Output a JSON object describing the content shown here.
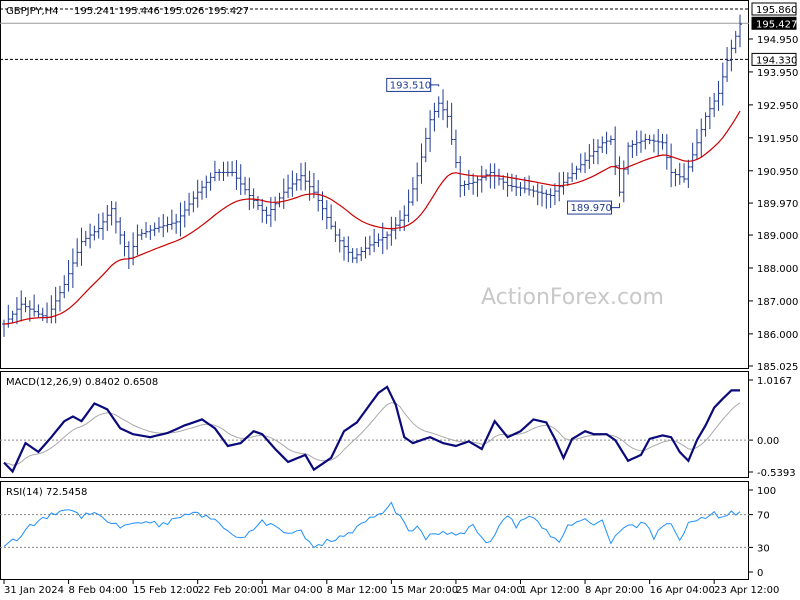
{
  "main": {
    "title": "GBPJPY,H4",
    "ohlc": "195.241 195.446 195.026 195.427",
    "watermark": "ActionForex.com",
    "price_labels": [
      "194.950",
      "193.950",
      "192.950",
      "191.950",
      "190.950",
      "189.970",
      "189.000",
      "188.000",
      "187.000",
      "186.000",
      "185.025"
    ],
    "axis_ticks": [
      194.95,
      193.95,
      192.95,
      191.95,
      190.95,
      189.97,
      189.0,
      188.0,
      187.0,
      186.0,
      185.025
    ],
    "hlines": {
      "top": 195.86,
      "current": 195.427,
      "resistance": 194.33
    },
    "boxed_labels": {
      "top": "195.860",
      "current": "195.427",
      "resistance": "194.330"
    },
    "annotations": [
      {
        "text": "193.510",
        "index": 101,
        "price": 193.51
      },
      {
        "text": "189.970",
        "index": 143,
        "price": 189.97
      }
    ]
  },
  "macd": {
    "title": "MACD(12,26,9) 0.8402 0.6508",
    "axis_labels": [
      "1.0167",
      "0.00",
      "-0.5393"
    ],
    "axis_values": [
      1.0167,
      0.0,
      -0.5393
    ]
  },
  "rsi": {
    "title": "RSI(14) 72.5458",
    "axis_labels": [
      "100",
      "70",
      "30",
      "0"
    ],
    "axis_values": [
      100,
      70,
      30,
      0
    ]
  },
  "time_axis": {
    "labels": [
      "31 Jan 2024",
      "8 Feb 04:00",
      "15 Feb 12:00",
      "22 Feb 20:00",
      "1 Mar 04:00",
      "8 Mar 12:00",
      "15 Mar 20:00",
      "25 Mar 04:00",
      "1 Apr 12:00",
      "8 Apr 20:00",
      "16 Apr 04:00",
      "23 Apr 12:00"
    ],
    "bar_index": [
      0,
      15,
      30,
      45,
      60,
      75,
      90,
      105,
      120,
      135,
      150,
      165
    ]
  },
  "colors": {
    "bars": "#1f3a93",
    "ma": "#cc0000",
    "macd": "#0a0a7a",
    "signal": "#aaaaaa",
    "rsi": "#1e90ff",
    "grid": "#888888"
  },
  "chart_data": [
    {
      "type": "ohlc",
      "title": "GBPJPY,H4",
      "moving_average": true,
      "ylim": [
        185.025,
        195.86
      ],
      "anchors": [
        [
          0,
          186.3
        ],
        [
          4,
          186.9
        ],
        [
          8,
          186.6
        ],
        [
          10,
          186.5
        ],
        [
          14,
          187.5
        ],
        [
          18,
          188.8
        ],
        [
          22,
          189.2
        ],
        [
          25,
          189.8
        ],
        [
          27,
          189.0
        ],
        [
          29,
          188.3
        ],
        [
          31,
          189.0
        ],
        [
          35,
          189.2
        ],
        [
          40,
          189.4
        ],
        [
          45,
          190.3
        ],
        [
          49,
          190.9
        ],
        [
          53,
          190.9
        ],
        [
          57,
          190.2
        ],
        [
          61,
          189.6
        ],
        [
          65,
          190.3
        ],
        [
          69,
          190.8
        ],
        [
          72,
          190.3
        ],
        [
          74,
          189.8
        ],
        [
          77,
          189.0
        ],
        [
          81,
          188.3
        ],
        [
          85,
          188.7
        ],
        [
          89,
          189.0
        ],
        [
          93,
          189.6
        ],
        [
          96,
          190.8
        ],
        [
          99,
          192.5
        ],
        [
          101,
          193.0
        ],
        [
          103,
          192.6
        ],
        [
          106,
          190.5
        ],
        [
          109,
          190.6
        ],
        [
          113,
          190.9
        ],
        [
          117,
          190.5
        ],
        [
          121,
          190.4
        ],
        [
          124,
          190.3
        ],
        [
          127,
          190.2
        ],
        [
          130,
          190.6
        ],
        [
          133,
          191.0
        ],
        [
          136,
          191.4
        ],
        [
          139,
          191.8
        ],
        [
          141,
          191.9
        ],
        [
          143,
          190.3
        ],
        [
          145,
          191.7
        ],
        [
          149,
          191.9
        ],
        [
          153,
          191.8
        ],
        [
          155,
          190.9
        ],
        [
          158,
          190.7
        ],
        [
          161,
          191.8
        ],
        [
          163,
          192.6
        ],
        [
          166,
          193.3
        ],
        [
          168,
          194.3
        ],
        [
          171,
          195.4
        ]
      ]
    },
    {
      "type": "line",
      "title": "MACD(12,26,9)",
      "series": [
        {
          "name": "MACD",
          "values": [
            0.8402
          ]
        },
        {
          "name": "Signal",
          "values": [
            0.6508
          ]
        }
      ],
      "ylim": [
        -0.5393,
        1.0167
      ],
      "anchors": [
        [
          0,
          -0.38
        ],
        [
          2,
          -0.53
        ],
        [
          5,
          -0.05
        ],
        [
          8,
          -0.2
        ],
        [
          11,
          0.05
        ],
        [
          14,
          0.32
        ],
        [
          16,
          0.4
        ],
        [
          18,
          0.32
        ],
        [
          21,
          0.62
        ],
        [
          24,
          0.52
        ],
        [
          27,
          0.2
        ],
        [
          30,
          0.1
        ],
        [
          34,
          0.05
        ],
        [
          38,
          0.12
        ],
        [
          42,
          0.25
        ],
        [
          46,
          0.35
        ],
        [
          49,
          0.2
        ],
        [
          52,
          -0.1
        ],
        [
          55,
          -0.05
        ],
        [
          58,
          0.15
        ],
        [
          60,
          0.1
        ],
        [
          63,
          -0.15
        ],
        [
          66,
          -0.37
        ],
        [
          70,
          -0.25
        ],
        [
          72,
          -0.5
        ],
        [
          76,
          -0.3
        ],
        [
          79,
          0.15
        ],
        [
          82,
          0.3
        ],
        [
          85,
          0.6
        ],
        [
          87,
          0.8
        ],
        [
          89,
          0.9
        ],
        [
          91,
          0.6
        ],
        [
          93,
          0.05
        ],
        [
          95,
          -0.05
        ],
        [
          99,
          0.05
        ],
        [
          102,
          -0.05
        ],
        [
          105,
          -0.1
        ],
        [
          108,
          -0.02
        ],
        [
          111,
          -0.15
        ],
        [
          114,
          0.32
        ],
        [
          117,
          0.05
        ],
        [
          120,
          0.15
        ],
        [
          123,
          0.35
        ],
        [
          126,
          0.3
        ],
        [
          128,
          0.02
        ],
        [
          130,
          -0.3
        ],
        [
          132,
          0.02
        ],
        [
          135,
          0.15
        ],
        [
          137,
          0.1
        ],
        [
          140,
          0.1
        ],
        [
          142,
          0.0
        ],
        [
          145,
          -0.35
        ],
        [
          148,
          -0.25
        ],
        [
          150,
          0.02
        ],
        [
          153,
          0.08
        ],
        [
          155,
          0.05
        ],
        [
          157,
          -0.2
        ],
        [
          159,
          -0.35
        ],
        [
          161,
          0.0
        ],
        [
          163,
          0.25
        ],
        [
          165,
          0.55
        ],
        [
          167,
          0.7
        ],
        [
          169,
          0.84
        ]
      ]
    },
    {
      "type": "line",
      "title": "RSI(14)",
      "series": [
        {
          "name": "RSI",
          "values": [
            72.5458
          ]
        }
      ],
      "ylim": [
        0,
        100
      ],
      "anchors": [
        [
          0,
          34
        ],
        [
          3,
          40
        ],
        [
          6,
          55
        ],
        [
          9,
          65
        ],
        [
          12,
          72
        ],
        [
          15,
          78
        ],
        [
          18,
          68
        ],
        [
          21,
          75
        ],
        [
          24,
          62
        ],
        [
          27,
          55
        ],
        [
          30,
          60
        ],
        [
          33,
          62
        ],
        [
          36,
          58
        ],
        [
          39,
          62
        ],
        [
          42,
          68
        ],
        [
          45,
          72
        ],
        [
          48,
          65
        ],
        [
          51,
          55
        ],
        [
          54,
          40
        ],
        [
          57,
          48
        ],
        [
          60,
          62
        ],
        [
          63,
          55
        ],
        [
          66,
          45
        ],
        [
          69,
          50
        ],
        [
          72,
          28
        ],
        [
          76,
          40
        ],
        [
          80,
          45
        ],
        [
          84,
          62
        ],
        [
          88,
          72
        ],
        [
          90,
          82
        ],
        [
          92,
          68
        ],
        [
          94,
          50
        ],
        [
          96,
          55
        ],
        [
          98,
          42
        ],
        [
          100,
          45
        ],
        [
          103,
          48
        ],
        [
          106,
          47
        ],
        [
          109,
          55
        ],
        [
          111,
          42
        ],
        [
          113,
          35
        ],
        [
          115,
          58
        ],
        [
          117,
          68
        ],
        [
          119,
          55
        ],
        [
          121,
          66
        ],
        [
          123,
          64
        ],
        [
          125,
          56
        ],
        [
          127,
          42
        ],
        [
          129,
          38
        ],
        [
          131,
          58
        ],
        [
          133,
          60
        ],
        [
          135,
          66
        ],
        [
          137,
          58
        ],
        [
          139,
          62
        ],
        [
          141,
          35
        ],
        [
          143,
          52
        ],
        [
          145,
          58
        ],
        [
          147,
          55
        ],
        [
          149,
          62
        ],
        [
          151,
          42
        ],
        [
          153,
          55
        ],
        [
          155,
          58
        ],
        [
          157,
          38
        ],
        [
          159,
          62
        ],
        [
          161,
          60
        ],
        [
          163,
          68
        ],
        [
          165,
          72
        ],
        [
          167,
          65
        ],
        [
          169,
          72
        ]
      ]
    }
  ]
}
